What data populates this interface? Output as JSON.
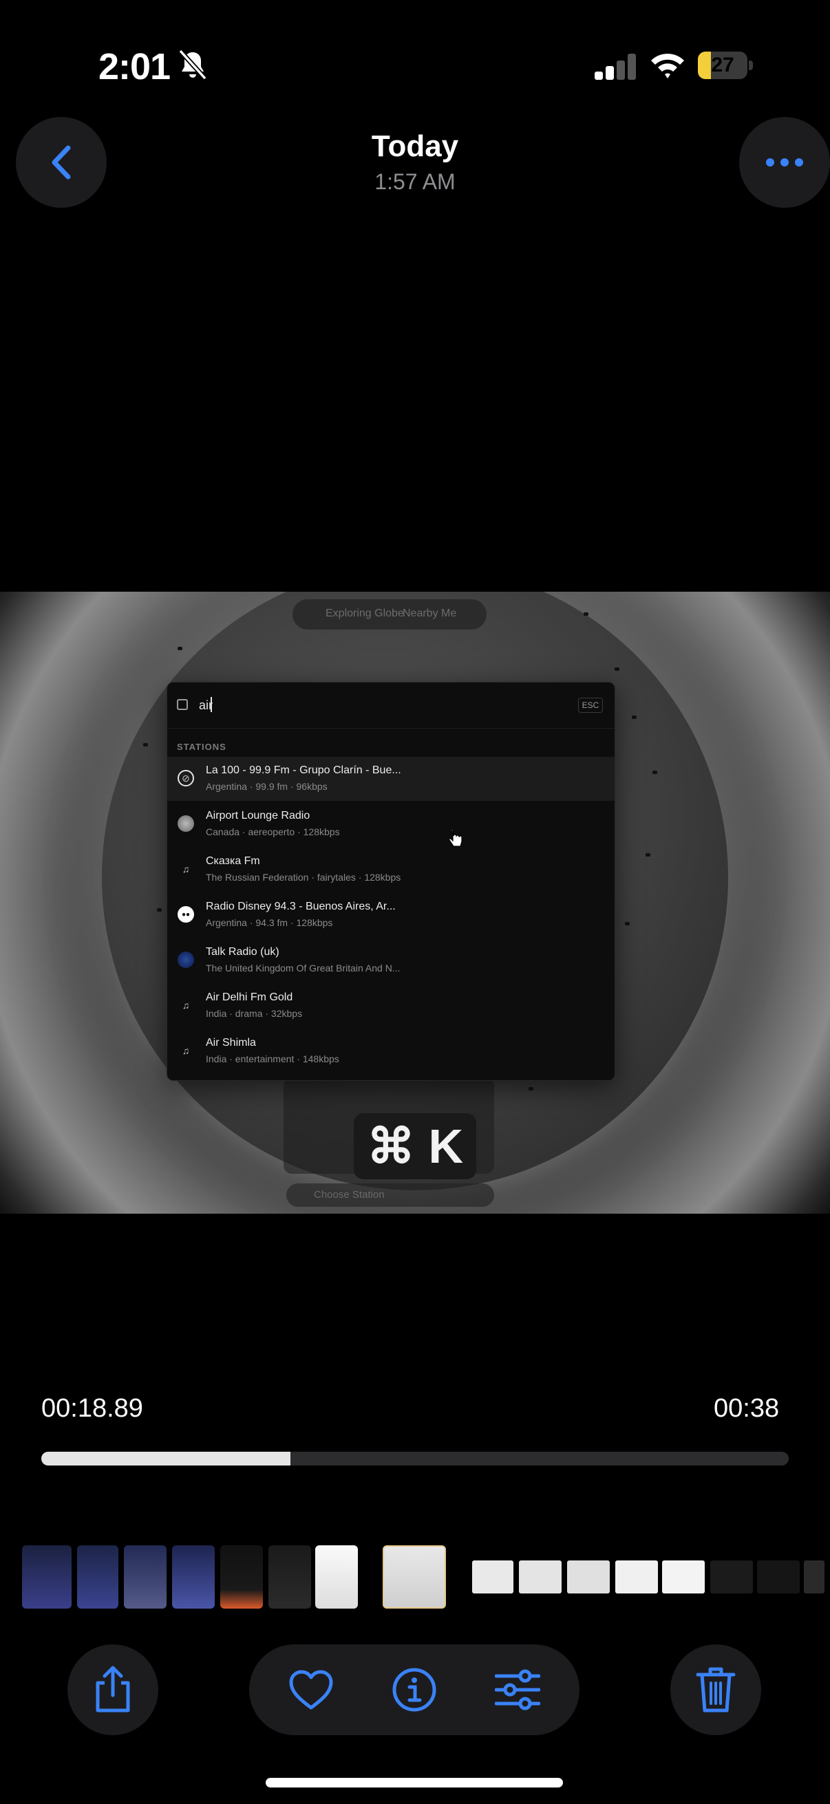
{
  "status_bar": {
    "time": "2:01",
    "battery": "27",
    "battery_level": 0.27
  },
  "header": {
    "title": "Today",
    "subtitle": "1:57 AM"
  },
  "video": {
    "globe_pill": {
      "left": "Exploring Globe",
      "right": "Nearby Me"
    },
    "palette": {
      "query": "air",
      "esc_label": "ESC",
      "section_label": "STATIONS",
      "stations": [
        {
          "name": "La 100 - 99.9 Fm - Grupo Clarín - Bue...",
          "meta": "Argentina · 99.9 fm · 96kbps",
          "icon": "circle-logo-icon"
        },
        {
          "name": "Airport Lounge Radio",
          "meta": "Canada · aereoperto · 128kbps",
          "icon": "globe-logo-icon"
        },
        {
          "name": "Сказка Fm",
          "meta": "The Russian Federation · fairytales · 128kbps",
          "icon": "music-note-icon"
        },
        {
          "name": "Radio Disney 94.3 - Buenos Aires, Ar...",
          "meta": "Argentina · 94.3 fm · 128kbps",
          "icon": "disney-logo-icon"
        },
        {
          "name": "Talk Radio (uk)",
          "meta": "The United Kingdom Of Great Britain And N...",
          "icon": "blue-logo-icon"
        },
        {
          "name": "Air Delhi Fm Gold",
          "meta": "India · drama · 32kbps",
          "icon": "music-note-icon"
        },
        {
          "name": "Air Shimla",
          "meta": "India · entertainment · 148kbps",
          "icon": "music-note-icon"
        }
      ]
    },
    "shortcut_hint": "⌘ K",
    "bottom_pill": "Choose Station"
  },
  "scrubber": {
    "elapsed": "00:18.89",
    "duration": "00:38",
    "progress": 0.333
  },
  "toolbar": {
    "share": "share-icon",
    "favorite": "heart-icon",
    "info": "info-icon",
    "adjust": "sliders-icon",
    "delete": "trash-icon"
  },
  "colors": {
    "accent": "#3a82f7",
    "battery": "#f2cf3b",
    "button_bg": "#1c1c1e"
  }
}
